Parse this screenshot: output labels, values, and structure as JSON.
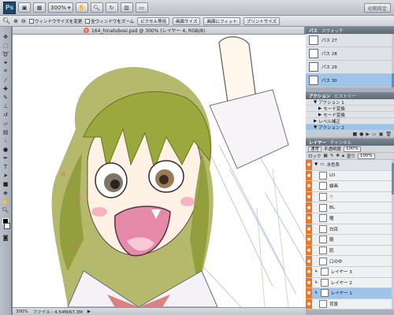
{
  "app": {
    "logo": "Ps",
    "zoom_level": "300%",
    "workspace_label": "初期設定"
  },
  "options_bar": {
    "resize_windows_label": "ウィンドウサイズを変更",
    "all_windows_zoom_label": "全ウィンドウをズーム",
    "actual_pixels_label": "ピクセル等倍",
    "fit_screen_label": "画面サイズ",
    "fill_screen_label": "画面にフィット",
    "print_size_label": "プリントサイズ"
  },
  "document": {
    "tab_title": "164_hinatubosi.psd @ 300% (レイヤー 4, RGB/8)",
    "status_zoom": "300%",
    "status_file": "ファイル : 4.54M/67.3M"
  },
  "paths_panel": {
    "tabs": [
      "パス",
      "スウォッチ"
    ],
    "paths": [
      "パス 27",
      "パス 28",
      "パス 29",
      "パス 30"
    ],
    "selected_index": 3
  },
  "actions_panel": {
    "tabs": [
      "アクション",
      "ヒストリー"
    ],
    "items": [
      {
        "label": "アクション 1",
        "indent": 1,
        "arrow": "▼"
      },
      {
        "label": "モード変換",
        "indent": 2,
        "arrow": "▶"
      },
      {
        "label": "モード変換",
        "indent": 2,
        "arrow": "▶"
      },
      {
        "label": "レベル補正",
        "indent": 1,
        "arrow": "▶"
      },
      {
        "label": "アクション 2",
        "indent": 1,
        "arrow": "▼"
      }
    ]
  },
  "layers_panel": {
    "tabs": [
      "レイヤー",
      "チャンネル"
    ],
    "blend_mode": "通常",
    "opacity_label": "不透明度",
    "opacity_value": "100%",
    "lock_label": "ロック",
    "fill_label": "塗り",
    "fill_value": "100%",
    "layers": [
      {
        "name": "水色系",
        "kind": "group"
      },
      {
        "name": "LO",
        "kind": "layer"
      },
      {
        "name": "線画",
        "kind": "layer"
      },
      {
        "name": "☆",
        "kind": "layer"
      },
      {
        "name": "BL",
        "kind": "layer"
      },
      {
        "name": "瞳",
        "kind": "layer"
      },
      {
        "name": "白目",
        "kind": "layer"
      },
      {
        "name": "服",
        "kind": "layer"
      },
      {
        "name": "肌",
        "kind": "layer"
      },
      {
        "name": "口の中",
        "kind": "layer"
      },
      {
        "name": "レイヤー 3",
        "kind": "layer"
      },
      {
        "name": "レイヤー 2",
        "kind": "layer"
      },
      {
        "name": "レイヤー 1",
        "kind": "layer"
      },
      {
        "name": "背景",
        "kind": "layer"
      }
    ],
    "selected_index": 12
  },
  "colors": {
    "accent_selection": "#9fc4ea",
    "eye_column": "#e8782e",
    "hair_green": "#9aa83e"
  }
}
